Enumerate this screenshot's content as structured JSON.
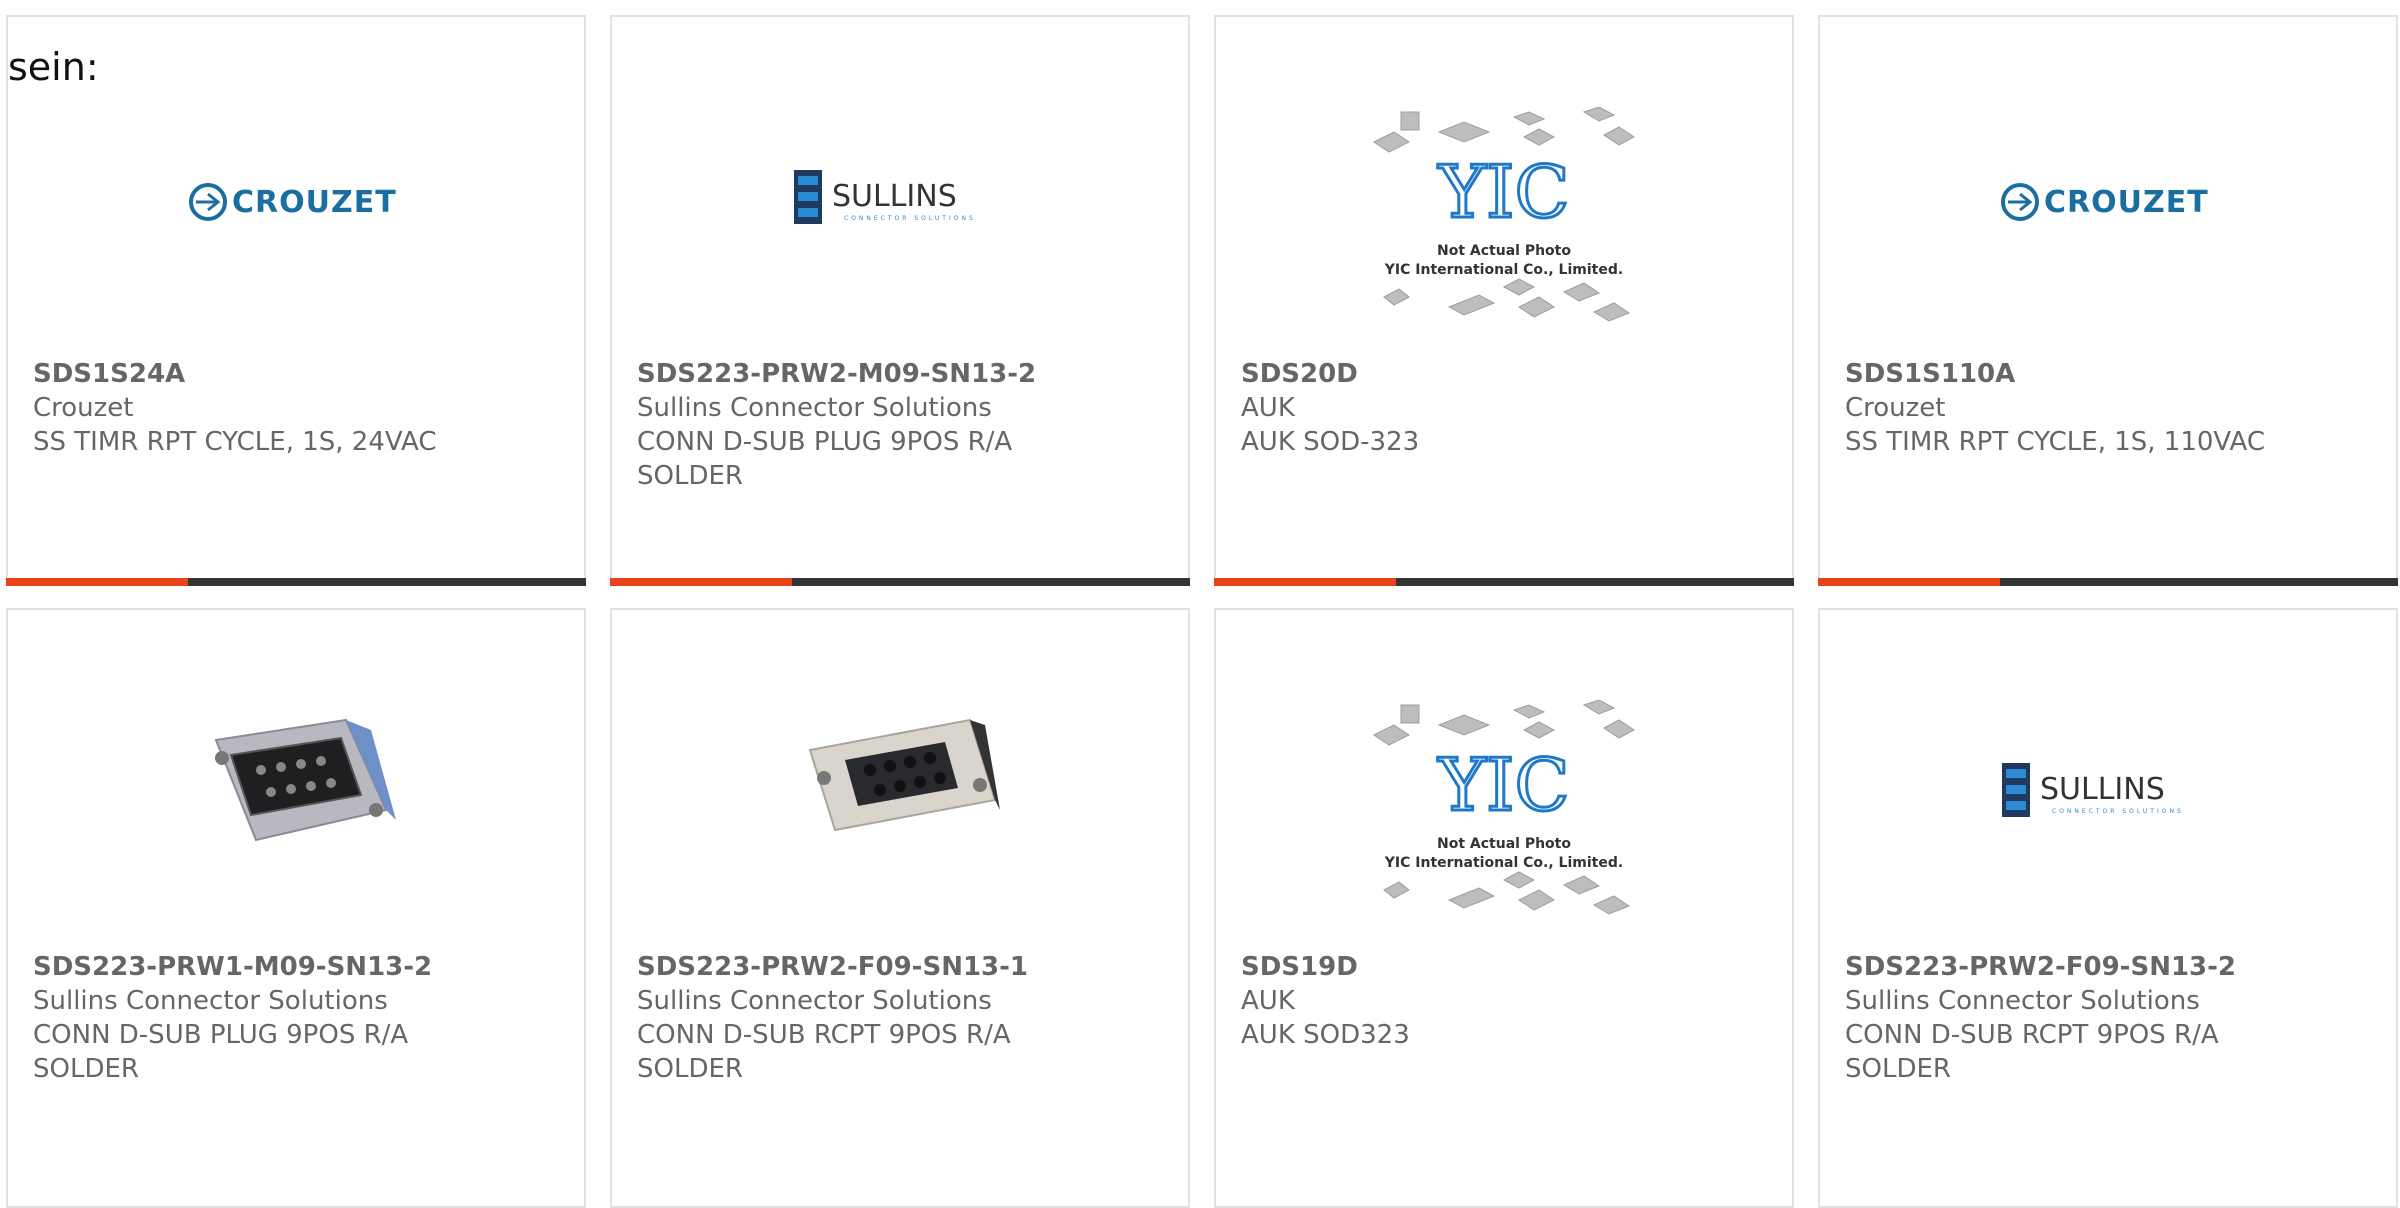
{
  "intro_text": "sein:",
  "colors": {
    "accent": "#e8431a",
    "bar": "#333333",
    "crouzet_blue": "#1a6fa0",
    "sullins_blue": "#1e5f9a",
    "yic_blue": "#1f78c8"
  },
  "products": [
    {
      "part_number": "SDS1S24A",
      "manufacturer": "Crouzet",
      "description": "SS TIMR RPT CYCLE, 1S, 24VAC",
      "image": "crouzet-logo",
      "logo_text": "CROUZET"
    },
    {
      "part_number": "SDS223-PRW2-M09-SN13-2",
      "manufacturer": "Sullins Connector Solutions",
      "description": "CONN D-SUB PLUG 9POS R/A SOLDER",
      "image": "sullins-logo",
      "logo_text": "SULLINS",
      "logo_tagline": "CONNECTOR SOLUTIONS"
    },
    {
      "part_number": "SDS20D",
      "manufacturer": "AUK",
      "description": "AUK SOD-323",
      "image": "yic-placeholder",
      "logo_text": "YIC",
      "note_line1": "Not Actual Photo",
      "note_line2": "YIC International Co., Limited."
    },
    {
      "part_number": "SDS1S110A",
      "manufacturer": "Crouzet",
      "description": "SS TIMR RPT CYCLE, 1S, 110VAC",
      "image": "crouzet-logo",
      "logo_text": "CROUZET"
    },
    {
      "part_number": "SDS223-PRW1-M09-SN13-2",
      "manufacturer": "Sullins Connector Solutions",
      "description": "CONN D-SUB PLUG 9POS R/A SOLDER",
      "image": "dsub-plug-photo"
    },
    {
      "part_number": "SDS223-PRW2-F09-SN13-1",
      "manufacturer": "Sullins Connector Solutions",
      "description": "CONN D-SUB RCPT 9POS R/A SOLDER",
      "image": "dsub-receptacle-photo"
    },
    {
      "part_number": "SDS19D",
      "manufacturer": "AUK",
      "description": "AUK SOD323",
      "image": "yic-placeholder",
      "logo_text": "YIC",
      "note_line1": "Not Actual Photo",
      "note_line2": "YIC International Co., Limited."
    },
    {
      "part_number": "SDS223-PRW2-F09-SN13-2",
      "manufacturer": "Sullins Connector Solutions",
      "description": "CONN D-SUB RCPT 9POS R/A SOLDER",
      "image": "sullins-logo",
      "logo_text": "SULLINS",
      "logo_tagline": "CONNECTOR SOLUTIONS"
    }
  ]
}
